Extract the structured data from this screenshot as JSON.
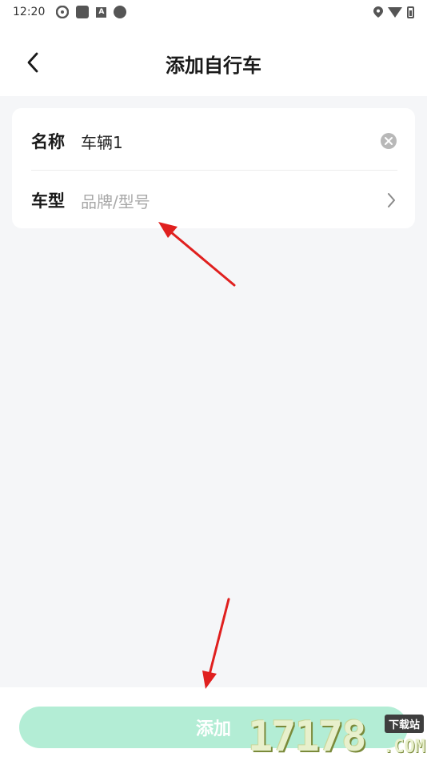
{
  "status_bar": {
    "time": "12:20"
  },
  "navbar": {
    "title": "添加自行车"
  },
  "form": {
    "name_label": "名称",
    "name_value": "车辆1",
    "type_label": "车型",
    "type_placeholder": "品牌/型号"
  },
  "footer": {
    "add_label": "添加"
  },
  "watermark": {
    "number": "17178",
    "tag": "下载站",
    "suffix": ".COM"
  },
  "colors": {
    "accent_disabled": "#b3edd5",
    "background": "#f5f6f8",
    "annotation_arrow": "#e0201f"
  }
}
